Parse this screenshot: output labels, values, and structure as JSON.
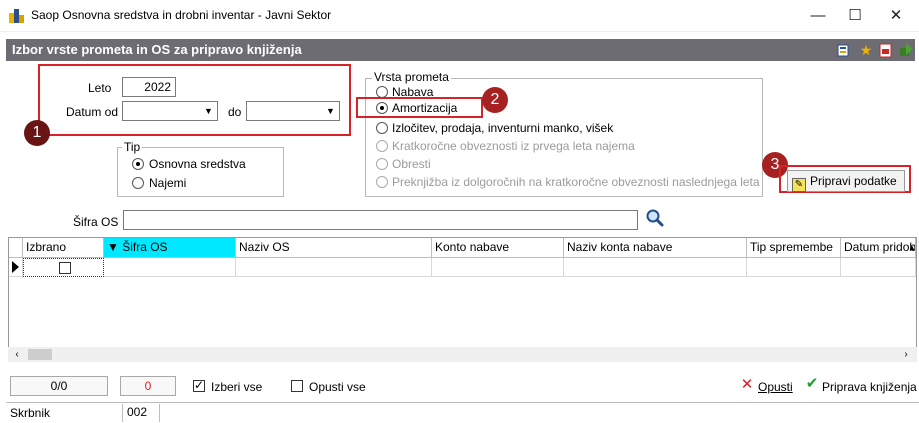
{
  "window": {
    "title": "Saop Osnovna sredstva in drobni inventar - Javni Sektor",
    "minimize": "—",
    "maximize": "☐",
    "close": "✕"
  },
  "header": {
    "title": "Izbor vrste prometa in OS za pripravo knjiženja"
  },
  "form": {
    "leto_label": "Leto",
    "leto_value": "2022",
    "datum_od_label": "Datum od",
    "do_label": "do"
  },
  "tip": {
    "legend": "Tip",
    "options": [
      "Osnovna sredstva",
      "Najemi"
    ]
  },
  "vrsta_prometa": {
    "legend": "Vrsta prometa",
    "options": [
      "Nabava",
      "Amortizacija",
      "Izločitev, prodaja, inventurni manko, višek",
      "Kratkoročne obveznosti iz prvega leta najema",
      "Obresti",
      "Preknjižba iz dolgoročnih na kratkoročne obveznosti naslednjega leta"
    ]
  },
  "badges": [
    "1",
    "2",
    "3"
  ],
  "buttons": {
    "pripravi": "Pripravi podatke",
    "opusti": "Opusti",
    "priprava": "Priprava knjiženja"
  },
  "search": {
    "label": "Šifra OS",
    "value": ""
  },
  "grid": {
    "columns": [
      "Izbrano",
      "▼ Šifra OS",
      "Naziv OS",
      "Konto nabave",
      "Naziv konta nabave",
      "Tip spremembe",
      "Datum pridob"
    ]
  },
  "status": {
    "count": "0/0",
    "selected": "0",
    "izberi_vse": "Izberi vse",
    "opusti_vse": "Opusti vse",
    "skrbnik_label": "Skrbnik",
    "skrbnik_value": "002"
  },
  "colors": {
    "header": "#6d6c72",
    "highlight": "#d6232a",
    "sorted_col": "#00e8ff"
  }
}
